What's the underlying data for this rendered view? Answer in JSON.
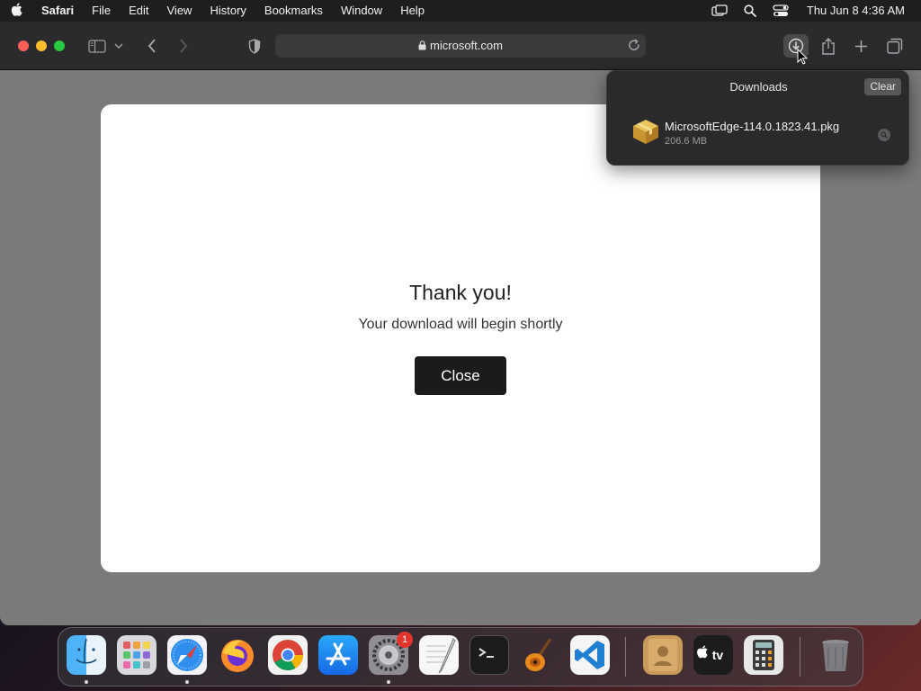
{
  "menubar": {
    "app_name": "Safari",
    "items": [
      "File",
      "Edit",
      "View",
      "History",
      "Bookmarks",
      "Window",
      "Help"
    ],
    "clock": "Thu Jun 8  4:36 AM",
    "status_icons": [
      "screen-mirroring-icon",
      "spotlight-search-icon",
      "control-center-icon"
    ]
  },
  "browser": {
    "url": "microsoft.com"
  },
  "page": {
    "title": "Thank you!",
    "subtitle": "Your download will begin shortly",
    "close_label": "Close"
  },
  "downloads_popover": {
    "title": "Downloads",
    "clear_label": "Clear",
    "items": [
      {
        "filename": "MicrosoftEdge-114.0.1823.41.pkg",
        "size": "206.6 MB"
      }
    ]
  },
  "dock": {
    "apps": [
      "finder",
      "launchpad",
      "safari",
      "firefox",
      "chrome",
      "app-store",
      "system-settings",
      "textedit",
      "terminal",
      "garageband",
      "vscode",
      "contacts",
      "apple-tv",
      "calculator",
      "trash"
    ],
    "badge_system_settings": "1",
    "appletv_label": "tv"
  },
  "colors": {
    "traffic_red": "#fe5f57",
    "traffic_yellow": "#febc2e",
    "traffic_green": "#28c840",
    "modal_button": "#1b1b1b"
  }
}
